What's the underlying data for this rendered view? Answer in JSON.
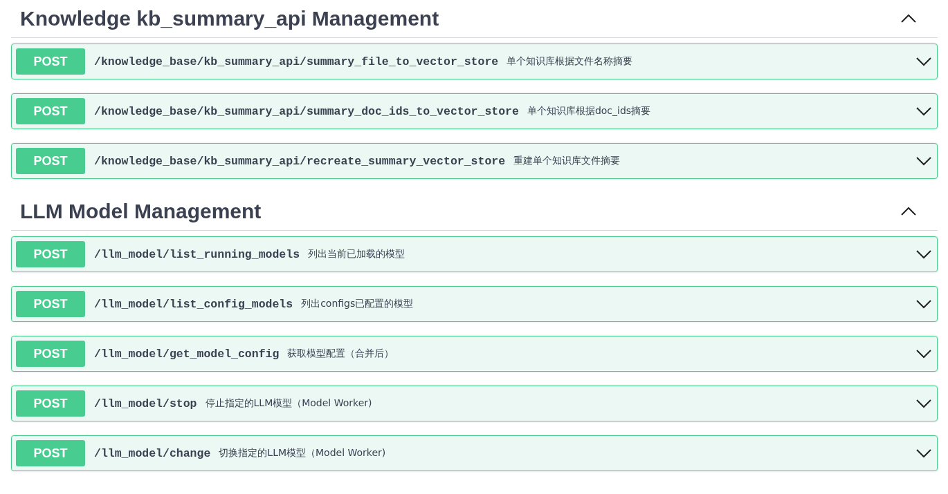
{
  "sections": [
    {
      "title": "Knowledge kb_summary_api Management",
      "expanded": true,
      "operations": [
        {
          "method": "POST",
          "path": "/knowledge_base/kb_summary_api/summary_file_to_vector_store",
          "summary": "单个知识库根据文件名称摘要",
          "expanded": false
        },
        {
          "method": "POST",
          "path": "/knowledge_base/kb_summary_api/summary_doc_ids_to_vector_store",
          "summary": "单个知识库根据doc_ids摘要",
          "expanded": false
        },
        {
          "method": "POST",
          "path": "/knowledge_base/kb_summary_api/recreate_summary_vector_store",
          "summary": "重建单个知识库文件摘要",
          "expanded": false
        }
      ]
    },
    {
      "title": "LLM Model Management",
      "expanded": true,
      "operations": [
        {
          "method": "POST",
          "path": "/llm_model/list_running_models",
          "summary": "列出当前已加载的模型",
          "expanded": false
        },
        {
          "method": "POST",
          "path": "/llm_model/list_config_models",
          "summary": "列出configs已配置的模型",
          "expanded": false
        },
        {
          "method": "POST",
          "path": "/llm_model/get_model_config",
          "summary": "获取模型配置（合并后）",
          "expanded": false
        },
        {
          "method": "POST",
          "path": "/llm_model/stop",
          "summary": "停止指定的LLM模型（Model Worker)",
          "expanded": false
        },
        {
          "method": "POST",
          "path": "/llm_model/change",
          "summary": "切换指定的LLM模型（Model Worker)",
          "expanded": false
        }
      ]
    }
  ]
}
